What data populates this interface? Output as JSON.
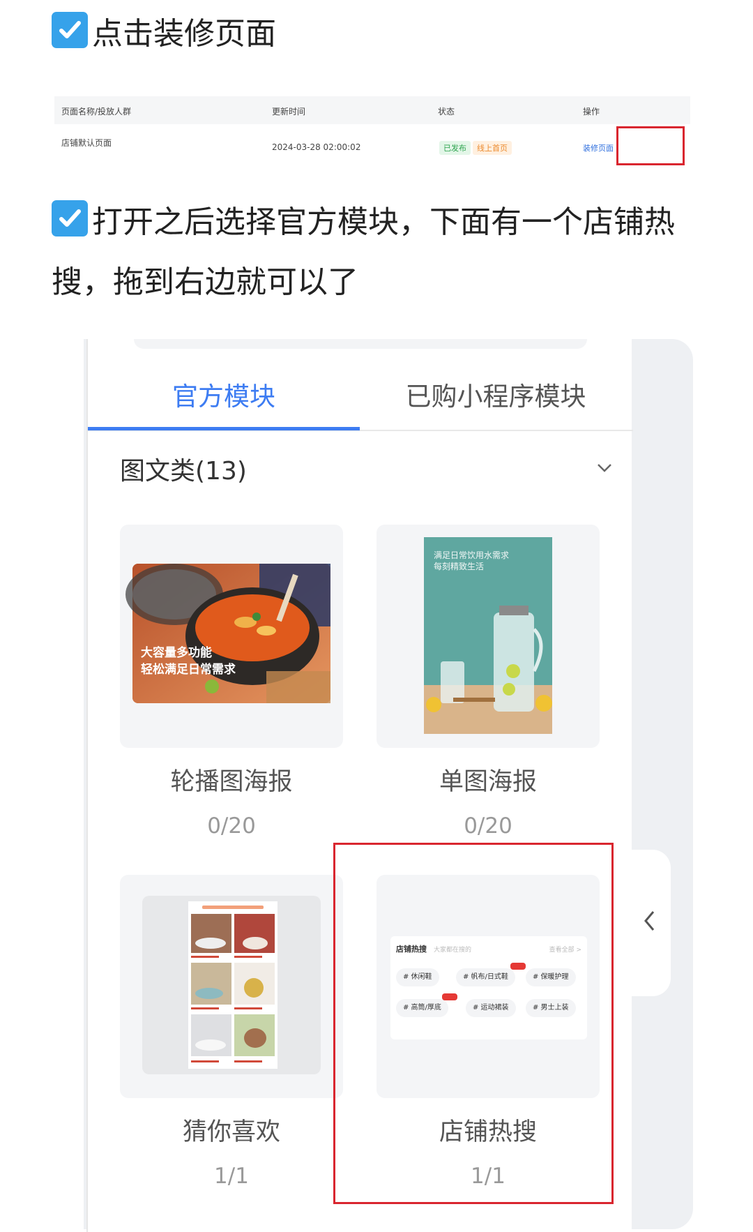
{
  "steps": [
    {
      "text": "点击装修页面"
    },
    {
      "text": "打开之后选择官方模块，下面有一个店铺热搜，拖到右边就可以了"
    }
  ],
  "table": {
    "headers": [
      "页面名称/投放人群",
      "更新时间",
      "状态",
      "操作"
    ],
    "row": {
      "name": "店铺默认页面",
      "updated": "2024-03-28 02:00:02",
      "status_badges": [
        "已发布",
        "线上首页"
      ],
      "action": "装修页面"
    }
  },
  "panel": {
    "tabs": [
      "官方模块",
      "已购小程序模块"
    ],
    "active_tab": "官方模块",
    "section_title": "图文类(13)",
    "cards": [
      {
        "name": "轮播图海报",
        "count": "0/20",
        "image_text": "大容量多功能\n轻松满足日常需求"
      },
      {
        "name": "单图海报",
        "count": "0/20",
        "image_text": "满足日常饮用水需求\n每刻精致生活"
      },
      {
        "name": "猜你喜欢",
        "count": "1/1"
      },
      {
        "name": "店铺热搜",
        "count": "1/1"
      }
    ],
    "hot_search_preview": {
      "title": "店铺热搜",
      "subtitle": "大家都在搜的",
      "more": "查看全部 >",
      "chips": [
        "# 休闲鞋",
        "# 帆布/日式鞋",
        "# 保暖护理",
        "# 高筒/厚底",
        "# 运动裙装",
        "# 男士上装"
      ]
    }
  },
  "colors": {
    "accent": "#3d7cf2",
    "highlight": "#d9262f",
    "check": "#36a2ea"
  }
}
